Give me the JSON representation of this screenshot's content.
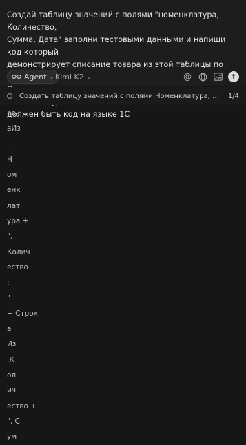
{
  "composer": {
    "prompt": "Создай таблицу значений с полями \"номенклатура, Количество,\nСумма, Дата\" заполни тестовыми данными и напиши код который\nдемонстрирует списание товара из этой таблицы по методу FIFO.\nПри списании указывается только количество и номенклатура. Это\nдолжен быть код на языке 1С",
    "agent_label": "Agent",
    "model_label": "Kimi K2",
    "icons": {
      "agent": "infinity-icon",
      "mention": "at-icon",
      "web": "globe-icon",
      "image": "image-icon",
      "send": "arrow-up-icon"
    }
  },
  "history": {
    "title": "Создать таблицу значений с полями Номенклатура, Количество, Сумма, Дата",
    "count": "1/4"
  },
  "code_lines": [
    "рок",
    "аИз",
    ".",
    "Н",
    "ом",
    "енк",
    "лат",
    "ура +",
    "\",",
    "Колич",
    "ество",
    ":",
    "\"",
    "+ Строк",
    "а",
    "Из",
    ".К",
    "ол",
    "ич",
    "ество +",
    "\", С",
    "ум"
  ]
}
